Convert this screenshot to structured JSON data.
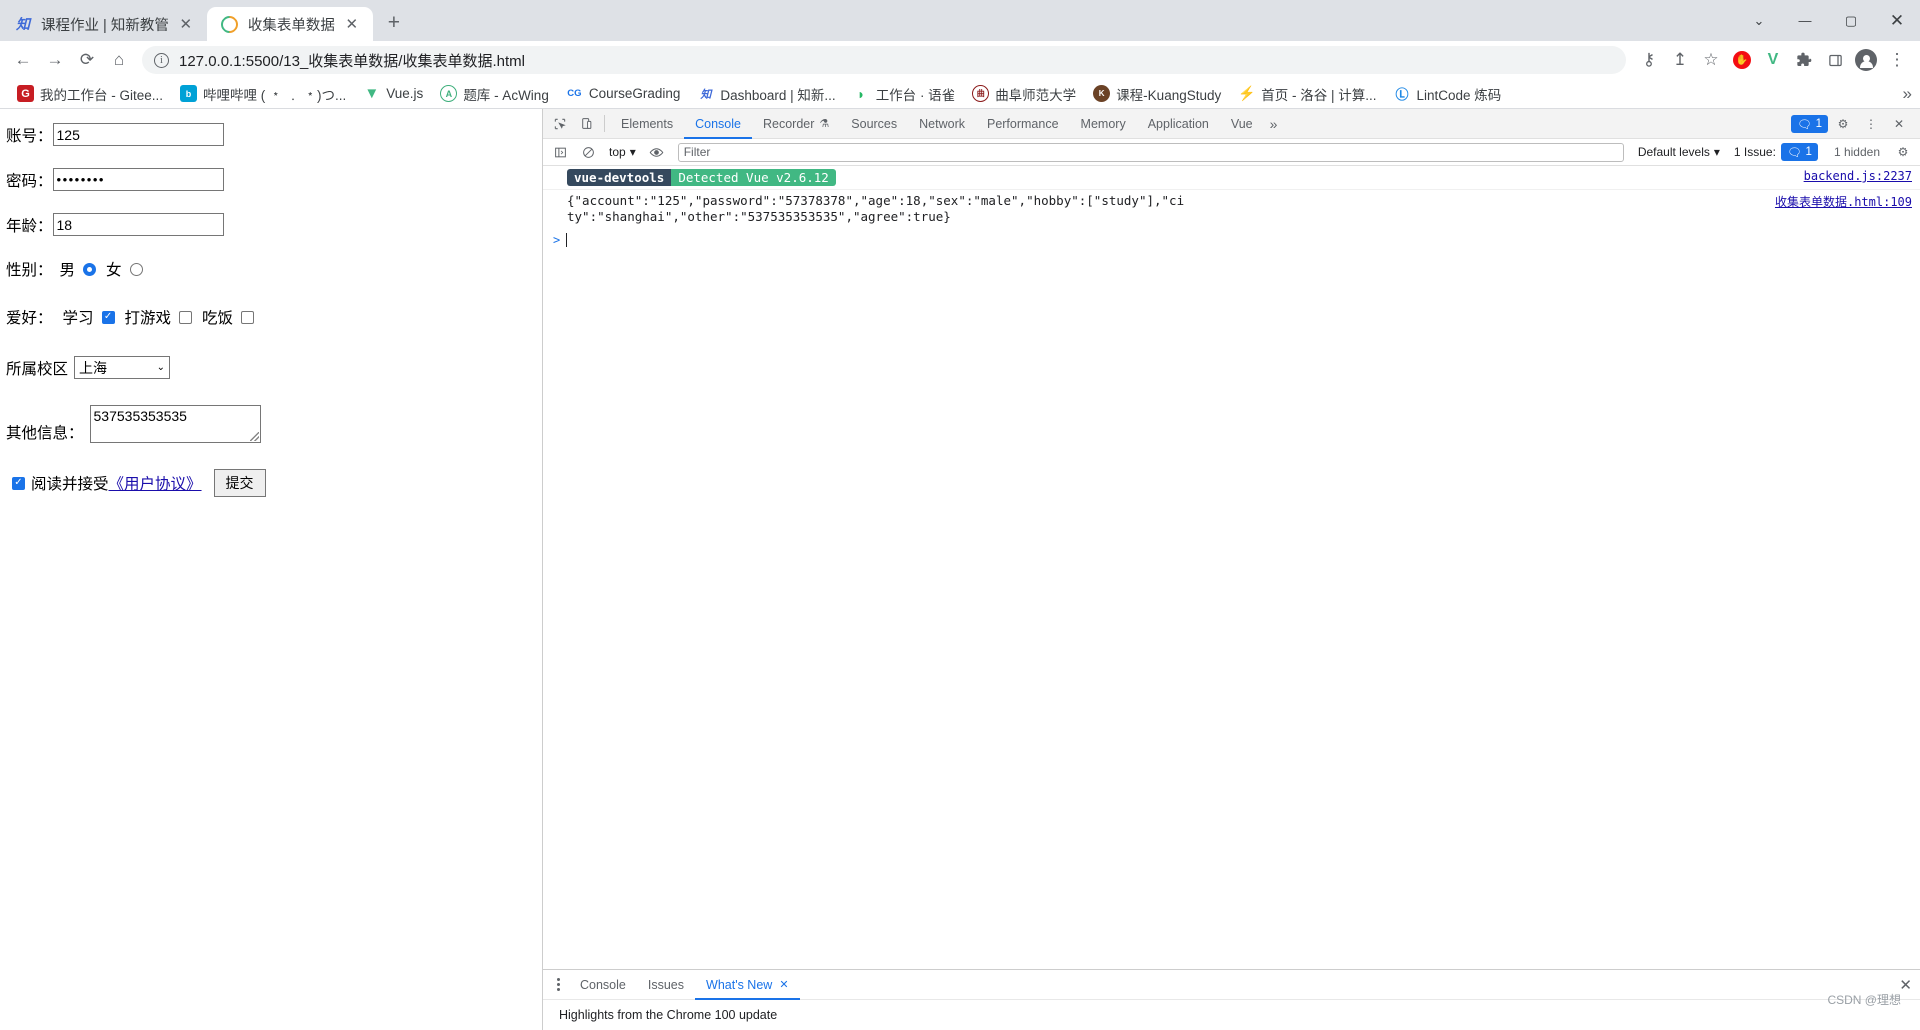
{
  "window": {
    "controls": {
      "minimize": "—",
      "maximize": "▢",
      "close": "✕",
      "chevron": "⌄"
    }
  },
  "tabs": [
    {
      "title": "课程作业 | 知新教管",
      "favicon": "zhixin-icon",
      "active": false,
      "close": "✕"
    },
    {
      "title": "收集表单数据",
      "favicon": "vue-icon",
      "active": true,
      "close": "✕"
    }
  ],
  "newtab_label": "+",
  "toolbar": {
    "back": "←",
    "forward": "→",
    "reload": "⟳",
    "home": "⌂",
    "info": "i",
    "url": "127.0.0.1:5500/13_收集表单数据/收集表单数据.html",
    "key_icon": "⚷",
    "share_icon": "↥",
    "star_icon": "☆",
    "ext_adblock": "",
    "ext_vue": "V",
    "ext_puzzle": "🧩",
    "ext_sidepanel": "▯",
    "profile": "avatar",
    "menu": "⋮"
  },
  "bookmarks": {
    "items": [
      {
        "label": "我的工作台 - Gitee...",
        "icon": "gitee-icon",
        "color": "#c71d23"
      },
      {
        "label": "哔哩哔哩 ( ﹡ ﹒ ﹡)つ...",
        "icon": "bilibili-icon",
        "color": "#00a1d6"
      },
      {
        "label": "Vue.js",
        "icon": "vuejs-icon",
        "color": "#41b883"
      },
      {
        "label": "题库 - AcWing",
        "icon": "acwing-icon",
        "color": "#3faf7c"
      },
      {
        "label": "CourseGrading",
        "icon": "coursegrading-icon",
        "color": "#1a73e8"
      },
      {
        "label": "Dashboard | 知新...",
        "icon": "zhixin-icon",
        "color": "#3f6ad8"
      },
      {
        "label": "工作台 · 语雀",
        "icon": "yuque-icon",
        "color": "#25b864"
      },
      {
        "label": "曲阜师范大学",
        "icon": "qfnu-icon",
        "color": "#8b1a1a"
      },
      {
        "label": "课程-KuangStudy",
        "icon": "kuangstudy-icon",
        "color": "#6b4226"
      },
      {
        "label": "首页 - 洛谷 | 计算...",
        "icon": "luogu-icon",
        "color": "#1e90ff"
      },
      {
        "label": "LintCode 炼码",
        "icon": "lintcode-icon",
        "color": "#1e88e5"
      }
    ],
    "overflow": "»"
  },
  "form": {
    "account": {
      "label": "账号：",
      "value": "125"
    },
    "password": {
      "label": "密码：",
      "value": "••••••••"
    },
    "age": {
      "label": "年龄：",
      "value": "18"
    },
    "sex": {
      "label": "性别：",
      "options": [
        {
          "label": "男",
          "checked": true
        },
        {
          "label": "女",
          "checked": false
        }
      ]
    },
    "hobby": {
      "label": "爱好：",
      "options": [
        {
          "label": "学习",
          "checked": true
        },
        {
          "label": "打游戏",
          "checked": false
        },
        {
          "label": "吃饭",
          "checked": false
        }
      ]
    },
    "campus": {
      "label": "所属校区",
      "value": "上海",
      "caret": "⌄"
    },
    "other": {
      "label": "其他信息：",
      "value": "537535353535"
    },
    "agree": {
      "checked": true,
      "check_glyph": "✓",
      "text": "阅读并接受",
      "link": "《用户协议》"
    },
    "submit_label": "提交"
  },
  "devtools": {
    "inspect_icon": "⬚",
    "device_icon": "▯",
    "tabs": [
      {
        "label": "Elements",
        "selected": false
      },
      {
        "label": "Console",
        "selected": true
      },
      {
        "label": "Recorder",
        "selected": false,
        "suffix": "⚗"
      },
      {
        "label": "Sources",
        "selected": false
      },
      {
        "label": "Network",
        "selected": false
      },
      {
        "label": "Performance",
        "selected": false
      },
      {
        "label": "Memory",
        "selected": false
      },
      {
        "label": "Application",
        "selected": false
      },
      {
        "label": "Vue",
        "selected": false
      }
    ],
    "tabs_overflow": "»",
    "issue_badge": {
      "icon": "💬",
      "count": "1"
    },
    "settings_icon": "⚙",
    "more_icon": "⋮",
    "close_icon": "✕",
    "filterbar": {
      "sidebar_icon": "▣",
      "clear_icon": "🚫",
      "context": "top",
      "context_caret": "▾",
      "eye_icon": "◉",
      "filter_placeholder": "Filter",
      "levels": "Default levels",
      "levels_caret": "▾",
      "issues_text": "1 Issue:",
      "issues_icon": "💬",
      "issues_count": "1",
      "hidden_text": "1 hidden",
      "gear_icon": "⚙"
    },
    "messages": [
      {
        "type": "vue-devtools",
        "badge_left": "vue-devtools",
        "badge_right": "Detected Vue v2.6.12",
        "source": "backend.js:2237"
      },
      {
        "type": "log",
        "text": "{\"account\":\"125\",\"password\":\"57378378\",\"age\":18,\"sex\":\"male\",\"hobby\":[\"study\"],\"city\":\"shanghai\",\"other\":\"537535353535\",\"agree\":true}",
        "source": "收集表单数据.html:109"
      }
    ],
    "prompt": {
      "arrow": ">"
    },
    "drawer": {
      "menu_icon": "⋮",
      "tabs": [
        {
          "label": "Console",
          "selected": false
        },
        {
          "label": "Issues",
          "selected": false
        },
        {
          "label": "What's New",
          "selected": true,
          "close": "✕"
        }
      ],
      "content": "Highlights from the Chrome 100 update",
      "close_icon": "✕"
    }
  },
  "watermark": "CSDN @理想ㅤ"
}
